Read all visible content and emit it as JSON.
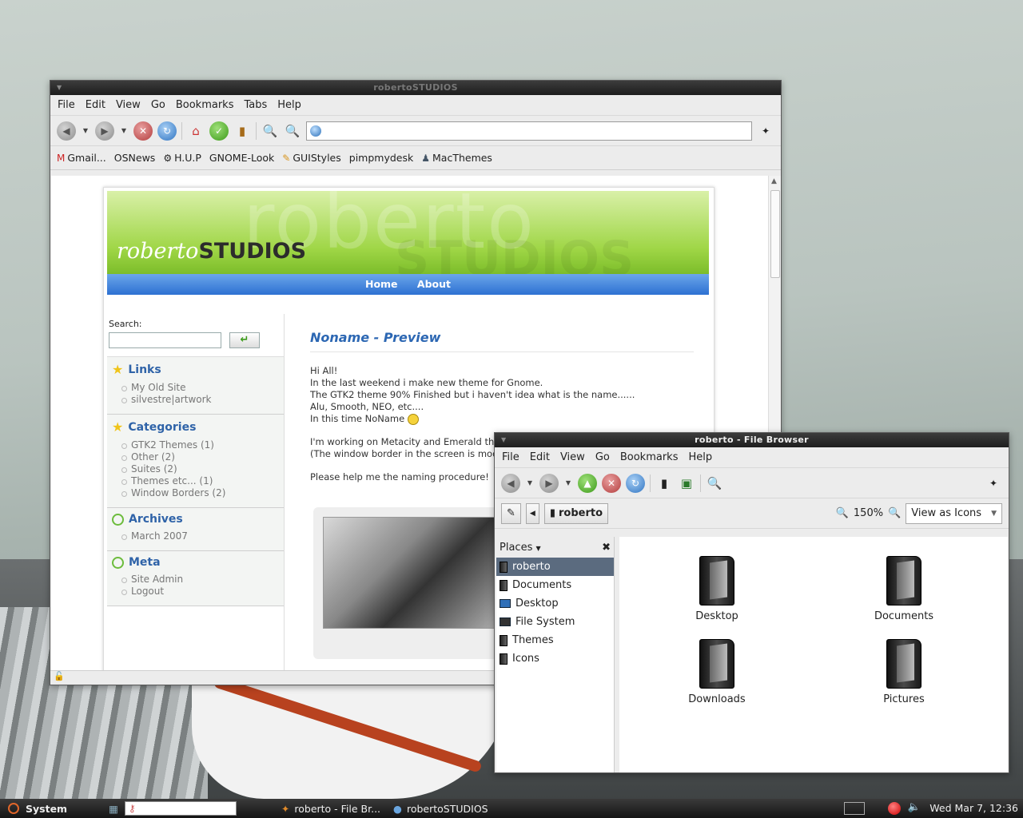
{
  "browser": {
    "title": "robertoSTUDIOS",
    "menu": [
      "File",
      "Edit",
      "View",
      "Go",
      "Bookmarks",
      "Tabs",
      "Help"
    ],
    "bookmarks": [
      "Gmail...",
      "OSNews",
      "H.U.P",
      "GNOME-Look",
      "GUIStyles",
      "pimpmydesk",
      "MacThemes"
    ],
    "site": {
      "logo_light": "roberto",
      "logo_bold": "STUDIOS",
      "nav": [
        "Home",
        "About"
      ],
      "search_label": "Search:",
      "links_title": "Links",
      "links": [
        "My Old Site",
        "silvestre|artwork"
      ],
      "categories_title": "Categories",
      "categories": [
        "GTK2 Themes (1)",
        "Other (2)",
        "Suites (2)",
        "Themes etc... (1)",
        "Window Borders (2)"
      ],
      "archives_title": "Archives",
      "archives": [
        "March 2007"
      ],
      "meta_title": "Meta",
      "meta": [
        "Site Admin",
        "Logout"
      ],
      "post_title": "Noname - Preview",
      "post_lines": [
        "Hi All!",
        "In the last weekend i make new theme for Gnome.",
        "The GTK2 theme 90% Finished but i haven't idea what is the name......",
        "Alu, Smooth, NEO, etc....",
        "In this time NoName"
      ],
      "post_lines2": [
        "I'm working on Metacity and Emerald then",
        "(The window border in the screen is mode"
      ],
      "post_lines3": "Please help me the naming procedure!"
    }
  },
  "filebrowser": {
    "title": "roberto - File Browser",
    "menu": [
      "File",
      "Edit",
      "View",
      "Go",
      "Bookmarks",
      "Help"
    ],
    "location": "roberto",
    "zoom": "150%",
    "view_mode": "View as Icons",
    "places_label": "Places",
    "places": [
      "roberto",
      "Documents",
      "Desktop",
      "File System",
      "Themes",
      "Icons"
    ],
    "files": [
      "Desktop",
      "Documents",
      "Downloads",
      "Pictures"
    ]
  },
  "panel": {
    "system": "System",
    "tasks": [
      "roberto - File Br...",
      "robertoSTUDIOS"
    ],
    "clock": "Wed Mar  7, 12:36"
  }
}
